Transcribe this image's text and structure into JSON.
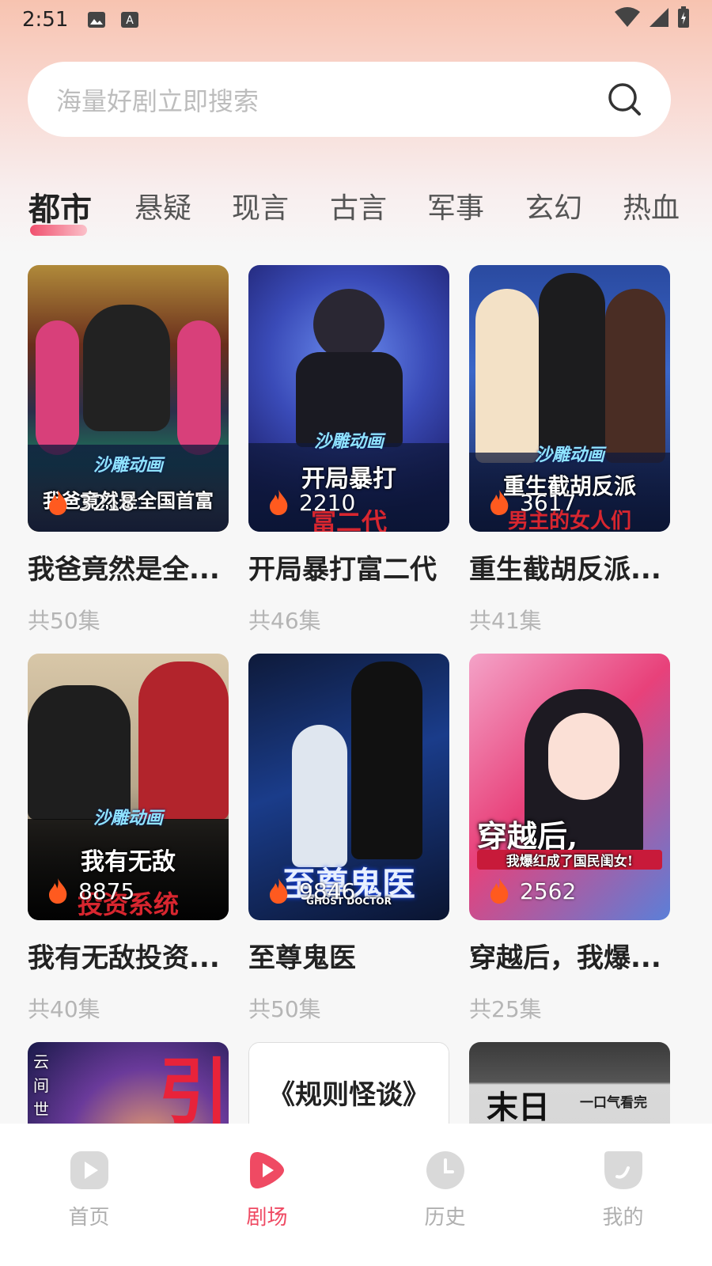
{
  "status_bar": {
    "time": "2:51"
  },
  "search": {
    "placeholder": "海量好剧立即搜索"
  },
  "tabs": [
    {
      "label": "都市",
      "active": true
    },
    {
      "label": "悬疑"
    },
    {
      "label": "现言"
    },
    {
      "label": "古言"
    },
    {
      "label": "军事"
    },
    {
      "label": "玄幻"
    },
    {
      "label": "热血"
    }
  ],
  "dramas": [
    {
      "title": "我爸竟然是全...",
      "episodes": "共50集",
      "heat": "3218",
      "poster_text": "我爸竟然是全国首富",
      "poster_tag": "沙雕动画"
    },
    {
      "title": "开局暴打富二代",
      "episodes": "共46集",
      "heat": "2210",
      "poster_text": "开局暴打",
      "poster_sub": "富二代",
      "poster_tag": "沙雕动画"
    },
    {
      "title": "重生截胡反派...",
      "episodes": "共41集",
      "heat": "3617",
      "poster_text": "重生截胡反派",
      "poster_sub": "男主的女人们",
      "poster_tag": "沙雕动画"
    },
    {
      "title": "我有无敌投资...",
      "episodes": "共40集",
      "heat": "8875",
      "poster_text": "我有无敌",
      "poster_sub": "投资系统",
      "poster_tag": "沙雕动画"
    },
    {
      "title": "至尊鬼医",
      "episodes": "共50集",
      "heat": "9846",
      "poster_text": "至尊鬼医",
      "poster_sub": "GHOST DOCTOR"
    },
    {
      "title": "穿越后，我爆...",
      "episodes": "共25集",
      "heat": "2562",
      "poster_text": "穿越后,",
      "poster_sub": "我爆红成了国民闺女!"
    },
    {
      "poster_text": "云间世",
      "poster_sub": "引"
    },
    {
      "poster_text": "《规则怪谈》"
    },
    {
      "poster_text": "末日",
      "poster_sub": "一口气看完"
    }
  ],
  "bottom_nav": [
    {
      "label": "首页",
      "icon": "play-square-icon"
    },
    {
      "label": "剧场",
      "icon": "play-circle-icon",
      "active": true
    },
    {
      "label": "历史",
      "icon": "clock-icon"
    },
    {
      "label": "我的",
      "icon": "profile-icon"
    }
  ],
  "colors": {
    "accent": "#ef4a63",
    "muted": "#b5b5b5"
  }
}
